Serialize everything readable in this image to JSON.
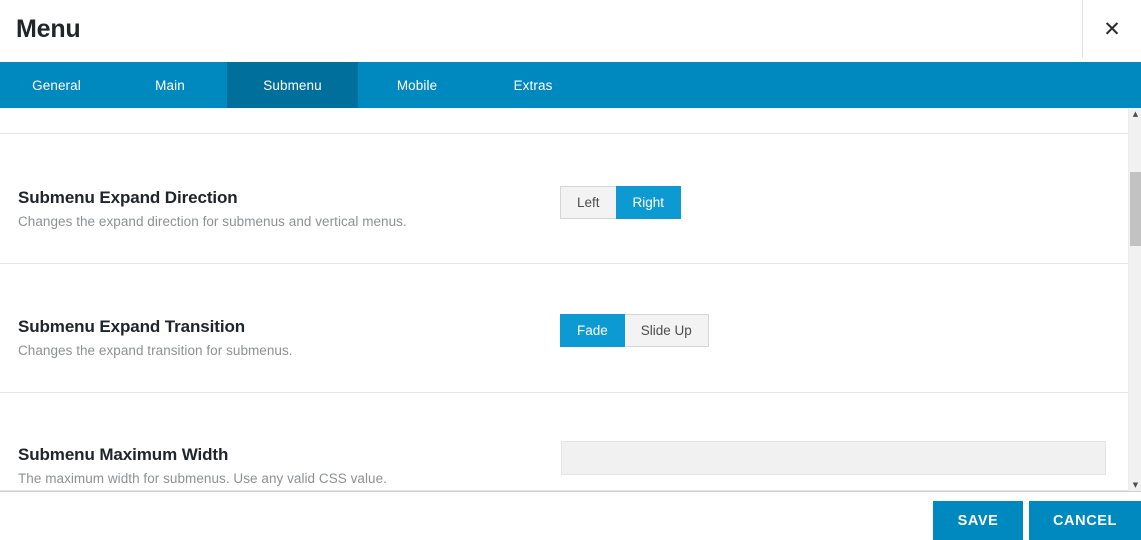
{
  "header": {
    "title": "Menu",
    "close_label": "✕"
  },
  "tabs": [
    {
      "label": "General",
      "active": false
    },
    {
      "label": "Main",
      "active": false
    },
    {
      "label": "Submenu",
      "active": true
    },
    {
      "label": "Mobile",
      "active": false
    },
    {
      "label": "Extras",
      "active": false
    }
  ],
  "settings": [
    {
      "label": "Submenu Expand Direction",
      "description": "Changes the expand direction for submenus and vertical menus.",
      "control": "button-group",
      "options": [
        "Left",
        "Right"
      ],
      "selected": "Right"
    },
    {
      "label": "Submenu Expand Transition",
      "description": "Changes the expand transition for submenus.",
      "control": "button-group",
      "options": [
        "Fade",
        "Slide Up"
      ],
      "selected": "Fade"
    },
    {
      "label": "Submenu Maximum Width",
      "description": "The maximum width for submenus. Use any valid CSS value.",
      "control": "text-input",
      "value": "",
      "placeholder": ""
    }
  ],
  "scrollbar": {
    "up_arrow": "▲",
    "down_arrow": "▼"
  },
  "footer": {
    "save_label": "SAVE",
    "cancel_label": "CANCEL"
  },
  "colors": {
    "tab_bar": "#0089bf",
    "tab_active": "#006f9c",
    "accent": "#0d9ad3",
    "button": "#0089bf",
    "text_dark": "#20252b",
    "text_muted": "#8c9194",
    "divider": "#e4e4e4"
  }
}
